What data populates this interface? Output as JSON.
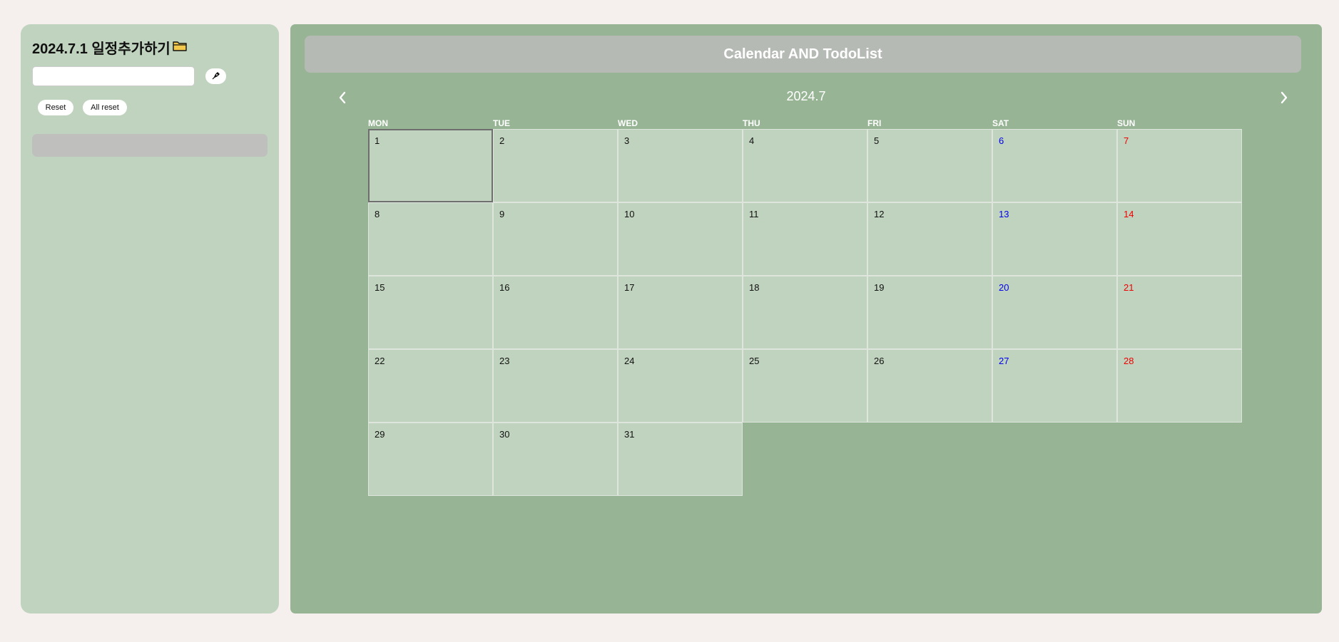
{
  "sidebar": {
    "title": "2024.7.1 일정추가하기",
    "input_value": "",
    "reset_label": "Reset",
    "all_reset_label": "All reset"
  },
  "main": {
    "header_title": "Calendar AND TodoList",
    "month_label": "2024.7"
  },
  "calendar": {
    "weekdays": [
      "MON",
      "TUE",
      "WED",
      "THU",
      "FRI",
      "SAT",
      "SUN"
    ],
    "selected_day": 1,
    "weeks": [
      [
        "1",
        "2",
        "3",
        "4",
        "5",
        "6",
        "7"
      ],
      [
        "8",
        "9",
        "10",
        "11",
        "12",
        "13",
        "14"
      ],
      [
        "15",
        "16",
        "17",
        "18",
        "19",
        "20",
        "21"
      ],
      [
        "22",
        "23",
        "24",
        "25",
        "26",
        "27",
        "28"
      ],
      [
        "29",
        "30",
        "31"
      ]
    ]
  },
  "colors": {
    "saturday": "#0000ee",
    "sunday": "#ee0000"
  },
  "icons": {
    "folder": "folder-icon",
    "add": "pen-nib-icon",
    "prev": "chevron-left-icon",
    "next": "chevron-right-icon"
  }
}
